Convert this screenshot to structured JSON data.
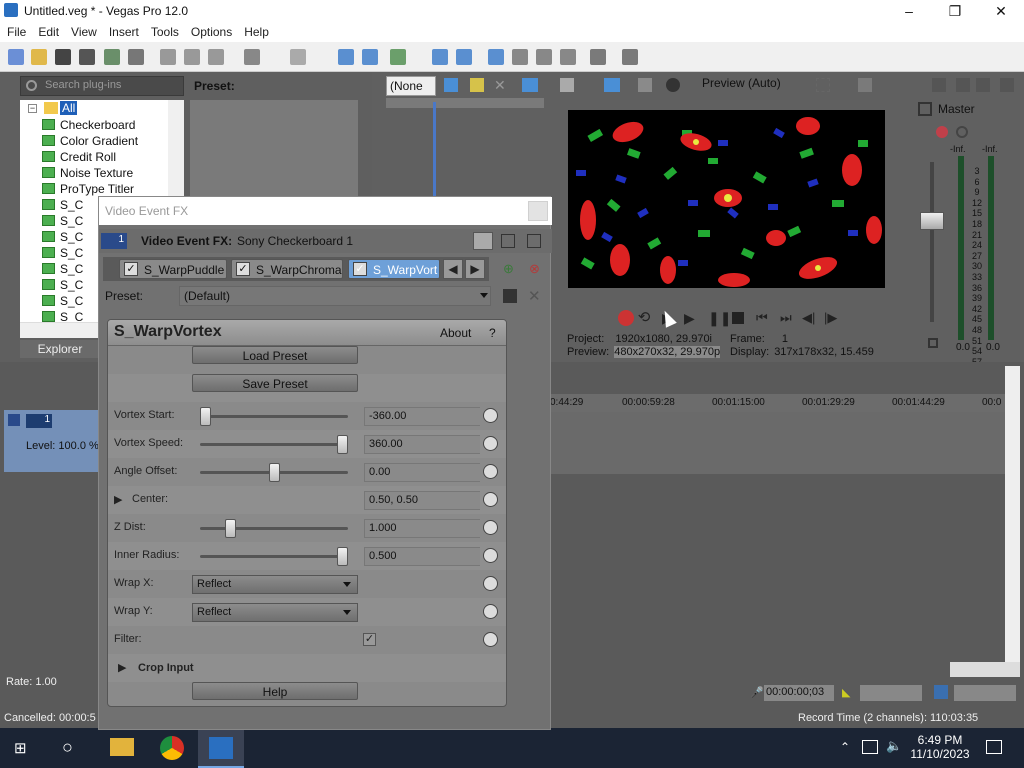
{
  "app": {
    "title": "Untitled.veg * - Vegas Pro 12.0",
    "min": "–",
    "max": "❐",
    "close": "✕"
  },
  "menu": [
    "File",
    "Edit",
    "View",
    "Insert",
    "Tools",
    "Options",
    "Help"
  ],
  "plugins": {
    "search_placeholder": "Search plug-ins",
    "root": "All",
    "items": [
      "Checkerboard",
      "Color Gradient",
      "Credit Roll",
      "Noise Texture",
      "ProType Titler",
      "S_C",
      "S_C",
      "S_C",
      "S_C",
      "S_C",
      "S_C",
      "S_C",
      "S_C"
    ],
    "tab": "Explorer",
    "preset_label": "Preset:"
  },
  "trimmer": {
    "dropdown": "(None"
  },
  "preview": {
    "mode": "Preview (Auto)",
    "project_label": "Project:",
    "project_value": "1920x1080, 29.970i",
    "frame_label": "Frame:",
    "frame_value": "1",
    "preview_label": "Preview:",
    "preview_value": "480x270x32, 29.970p",
    "display_label": "Display:",
    "display_value": "317x178x32, 15.459"
  },
  "master": {
    "label": "Master",
    "left_peak": "-Inf.",
    "right_peak": "-Inf.",
    "scale": [
      "3",
      "6",
      "9",
      "12",
      "15",
      "18",
      "21",
      "24",
      "27",
      "30",
      "33",
      "36",
      "39",
      "42",
      "45",
      "48",
      "51",
      "54",
      "57"
    ],
    "left_val": "0.0",
    "right_val": "0.0"
  },
  "timeline": {
    "marks": [
      "0:44:29",
      "00:00:59:28",
      "00:01:15:00",
      "00:01:29:29",
      "00:01:44:29",
      "00:0"
    ],
    "track_num": "1",
    "level": "Level: 100.0 %",
    "rate": "Rate: 1.00",
    "timecode": "00:00:00;03"
  },
  "status": {
    "left": "Cancelled: 00:00:5",
    "right": "Record Time (2 channels): 110:03:35"
  },
  "fx": {
    "window_title": "Video Event FX",
    "header_num": "1",
    "header_label": "Video Event FX:",
    "header_value": "Sony Checkerboard 1",
    "chain": [
      "S_WarpPuddle",
      "S_WarpChroma",
      "S_WarpVort"
    ],
    "preset_label": "Preset:",
    "preset_value": "(Default)",
    "plugin_name": "S_WarpVortex",
    "about": "About",
    "help_q": "?",
    "load_preset": "Load Preset",
    "save_preset": "Save Preset",
    "params": [
      {
        "label": "Vortex Start:",
        "value": "-360.00",
        "level": 0
      },
      {
        "label": "Vortex Speed:",
        "value": "360.00",
        "level": 1
      },
      {
        "label": "Angle Offset:",
        "value": "0.00",
        "level": 0.5
      },
      {
        "label": "Center:",
        "value": "0.50, 0.50"
      },
      {
        "label": "Z Dist:",
        "value": "1.000",
        "level": 0.18
      },
      {
        "label": "Inner Radius:",
        "value": "0.500",
        "level": 1
      }
    ],
    "wrap_x_label": "Wrap X:",
    "wrap_x": "Reflect",
    "wrap_y_label": "Wrap Y:",
    "wrap_y": "Reflect",
    "filter_label": "Filter:",
    "crop_input": "Crop Input",
    "help": "Help"
  },
  "taskbar": {
    "time": "6:49 PM",
    "date": "11/10/2023"
  }
}
